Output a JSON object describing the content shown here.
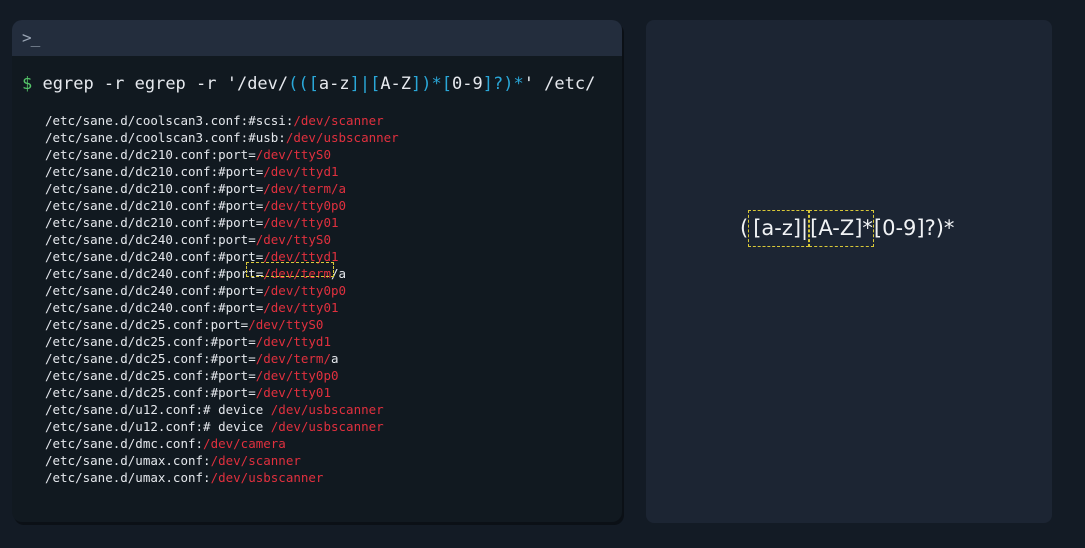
{
  "terminal": {
    "prompt_glyph": ">_",
    "command": {
      "dollar": "$",
      "prefix": "egrep -r egrep -r '/dev/",
      "regex_parts": [
        "((",
        "[a-z]",
        "|",
        "[",
        "A-Z",
        "]",
        ")*",
        "[",
        "0-9",
        "]",
        "?)*"
      ],
      "suffix": "' /etc/"
    },
    "output": [
      {
        "path": "/etc/sane.d/coolscan3.conf:#scsi:",
        "dev": "/dev/scanner",
        "tail": ""
      },
      {
        "path": "/etc/sane.d/coolscan3.conf:#usb:",
        "dev": "/dev/usbscanner",
        "tail": ""
      },
      {
        "path": "/etc/sane.d/dc210.conf:port=",
        "dev": "/dev/ttyS0",
        "tail": ""
      },
      {
        "path": "/etc/sane.d/dc210.conf:#port=",
        "dev": "/dev/ttyd1",
        "tail": ""
      },
      {
        "path": "/etc/sane.d/dc210.conf:#port=",
        "dev": "/dev/term/a",
        "tail": ""
      },
      {
        "path": "/etc/sane.d/dc210.conf:#port=",
        "dev": "/dev/tty0p0",
        "tail": ""
      },
      {
        "path": "/etc/sane.d/dc210.conf:#port=",
        "dev": "/dev/tty01",
        "tail": ""
      },
      {
        "path": "/etc/sane.d/dc240.conf:port=",
        "dev": "/dev/ttyS0",
        "tail": ""
      },
      {
        "path": "/etc/sane.d/dc240.conf:#port=",
        "dev": "/dev/ttyd1",
        "tail": ""
      },
      {
        "path": "/etc/sane.d/dc240.conf:#port=",
        "dev": "/dev/term",
        "tail": "/a"
      },
      {
        "path": "/etc/sane.d/dc240.conf:#port=",
        "dev": "/dev/tty0p0",
        "tail": ""
      },
      {
        "path": "/etc/sane.d/dc240.conf:#port=",
        "dev": "/dev/tty01",
        "tail": ""
      },
      {
        "path": "/etc/sane.d/dc25.conf:port=",
        "dev": "/dev/ttyS0",
        "tail": ""
      },
      {
        "path": "/etc/sane.d/dc25.conf:#port=",
        "dev": "/dev/ttyd1",
        "tail": ""
      },
      {
        "path": "/etc/sane.d/dc25.conf:#port=",
        "dev": "/dev/term/",
        "tail": "a"
      },
      {
        "path": "/etc/sane.d/dc25.conf:#port=",
        "dev": "/dev/tty0p0",
        "tail": ""
      },
      {
        "path": "/etc/sane.d/dc25.conf:#port=",
        "dev": "/dev/tty01",
        "tail": ""
      },
      {
        "path": "/etc/sane.d/u12.conf:# device ",
        "dev": "/dev/usbscanner",
        "tail": ""
      },
      {
        "path": "/etc/sane.d/u12.conf:# device ",
        "dev": "/dev/usbscanner",
        "tail": ""
      },
      {
        "path": "/etc/sane.d/dmc.conf:",
        "dev": "/dev/camera",
        "tail": ""
      },
      {
        "path": "/etc/sane.d/umax.conf:",
        "dev": "/dev/scanner",
        "tail": ""
      },
      {
        "path": "/etc/sane.d/umax.conf:",
        "dev": "/dev/usbscanner",
        "tail": ""
      }
    ]
  },
  "visualizer": {
    "open": "(",
    "group1": "[a-z]|",
    "group2": "[A-Z]*",
    "rest": "[0-9]?)*"
  },
  "colors": {
    "dev_path": "#e0303e",
    "regex": "#2aa7d8",
    "prompt": "#56c66a",
    "highlight": "#d8c838"
  }
}
